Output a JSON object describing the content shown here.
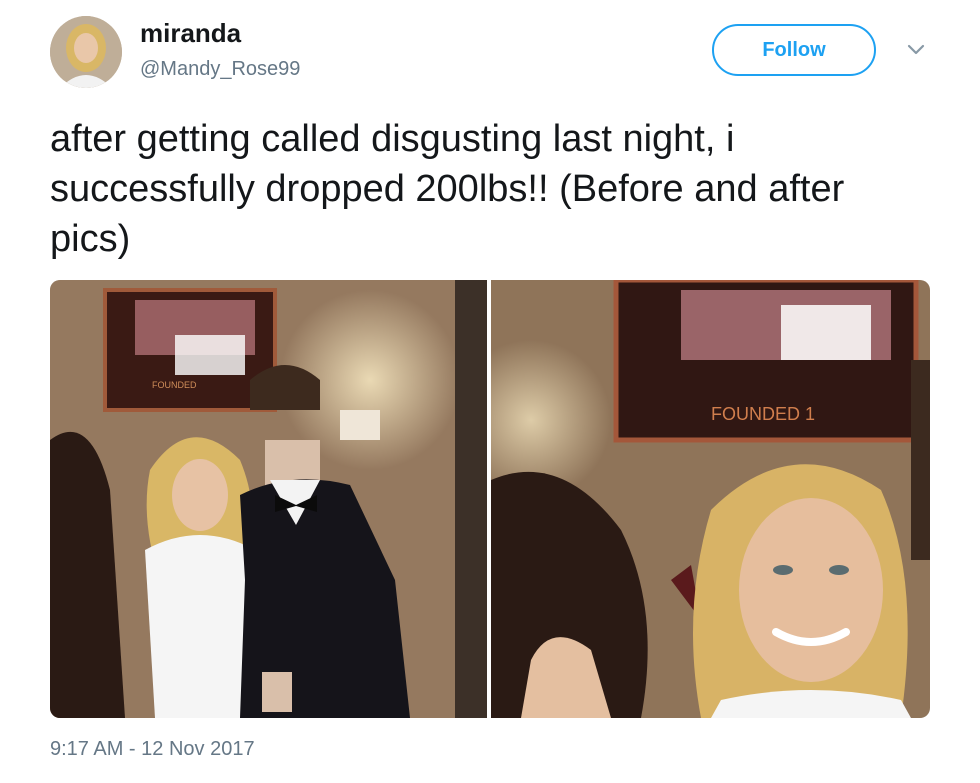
{
  "user": {
    "display_name": "miranda",
    "handle": "@Mandy_Rose99"
  },
  "actions": {
    "follow_label": "Follow",
    "more_icon": "chevron-down-icon"
  },
  "tweet": {
    "text": "after getting called disgusting last night, i successfully dropped 200lbs!! (Before and after pics)",
    "timestamp": "9:17 AM - 12 Nov 2017"
  },
  "media": {
    "photo_count": 2,
    "sign_text": "FOUNDED",
    "sign_text_right": "FOUNDED 1"
  },
  "colors": {
    "accent": "#1da1f2",
    "text": "#14171a",
    "secondary": "#657786"
  }
}
